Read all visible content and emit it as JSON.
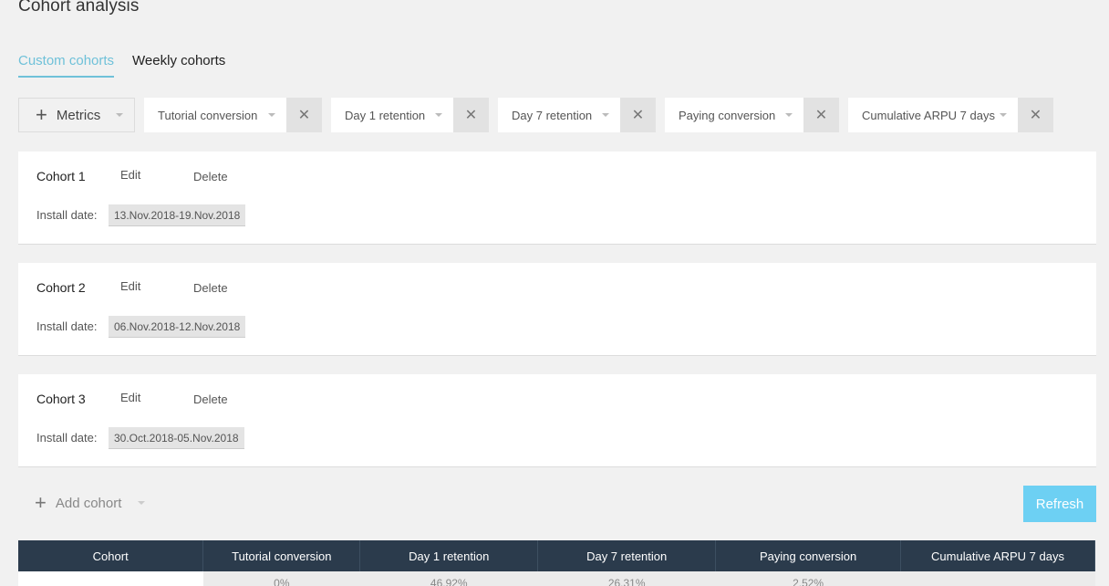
{
  "page_title": "Cohort analysis",
  "tabs": [
    {
      "label": "Custom cohorts",
      "active": true
    },
    {
      "label": "Weekly cohorts",
      "active": false
    }
  ],
  "metrics_button": "Metrics",
  "metric_chips": [
    {
      "label": "Tutorial conversion"
    },
    {
      "label": "Day 1 retention"
    },
    {
      "label": "Day 7 retention"
    },
    {
      "label": "Paying conversion"
    },
    {
      "label": "Cumulative ARPU 7 days"
    }
  ],
  "cohorts": [
    {
      "name": "Cohort 1",
      "edit": "Edit",
      "delete": "Delete",
      "install_label": "Install date:",
      "install_date": "13.Nov.2018-19.Nov.2018"
    },
    {
      "name": "Cohort 2",
      "edit": "Edit",
      "delete": "Delete",
      "install_label": "Install date:",
      "install_date": "06.Nov.2018-12.Nov.2018"
    },
    {
      "name": "Cohort 3",
      "edit": "Edit",
      "delete": "Delete",
      "install_label": "Install date:",
      "install_date": "30.Oct.2018-05.Nov.2018"
    }
  ],
  "add_cohort": "Add cohort",
  "refresh": "Refresh",
  "table": {
    "headers": [
      "Cohort",
      "Tutorial conversion",
      "Day 1 retention",
      "Day 7 retention",
      "Paying conversion",
      "Cumulative ARPU 7 days"
    ],
    "rows": [
      [
        "",
        "0%",
        "46.92%",
        "26.31%",
        "2.52%",
        ""
      ]
    ]
  },
  "colors": {
    "accent": "#6fc1d9",
    "refresh": "#6dd0f3",
    "table_header": "#2b3b4c"
  }
}
